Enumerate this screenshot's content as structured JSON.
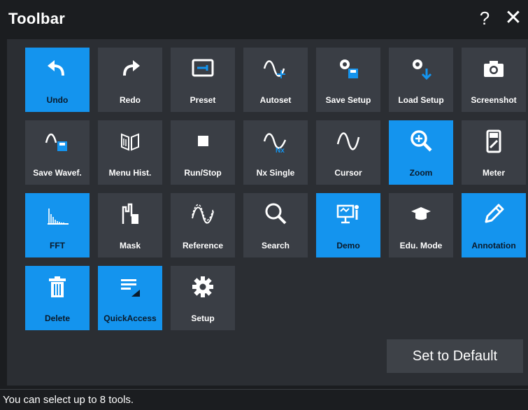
{
  "window": {
    "title": "Toolbar",
    "help_glyph": "?",
    "close_glyph": "✕"
  },
  "tools": [
    {
      "label": "Undo",
      "icon": "undo-icon",
      "active": true
    },
    {
      "label": "Redo",
      "icon": "redo-icon",
      "active": false
    },
    {
      "label": "Preset",
      "icon": "preset-icon",
      "active": false
    },
    {
      "label": "Autoset",
      "icon": "autoset-icon",
      "active": false
    },
    {
      "label": "Save Setup",
      "icon": "save-setup-icon",
      "active": false
    },
    {
      "label": "Load Setup",
      "icon": "load-setup-icon",
      "active": false
    },
    {
      "label": "Screenshot",
      "icon": "camera-icon",
      "active": false
    },
    {
      "label": "Save Wavef.",
      "icon": "save-waveform-icon",
      "active": false
    },
    {
      "label": "Menu Hist.",
      "icon": "menu-history-icon",
      "active": false
    },
    {
      "label": "Run/Stop",
      "icon": "stop-icon",
      "active": false
    },
    {
      "label": "Nx Single",
      "icon": "nx-single-icon",
      "active": false,
      "badge": "Nx"
    },
    {
      "label": "Cursor",
      "icon": "cursor-wave-icon",
      "active": false
    },
    {
      "label": "Zoom",
      "icon": "zoom-icon",
      "active": true
    },
    {
      "label": "Meter",
      "icon": "meter-icon",
      "active": false
    },
    {
      "label": "FFT",
      "icon": "fft-icon",
      "active": true
    },
    {
      "label": "Mask",
      "icon": "mask-icon",
      "active": false
    },
    {
      "label": "Reference",
      "icon": "reference-icon",
      "active": false
    },
    {
      "label": "Search",
      "icon": "search-icon",
      "active": false
    },
    {
      "label": "Demo",
      "icon": "demo-icon",
      "active": true
    },
    {
      "label": "Edu. Mode",
      "icon": "education-icon",
      "active": false
    },
    {
      "label": "Annotation",
      "icon": "pencil-icon",
      "active": true
    },
    {
      "label": "Delete",
      "icon": "trash-icon",
      "active": true
    },
    {
      "label": "QuickAccess",
      "icon": "quick-access-icon",
      "active": true
    },
    {
      "label": "Setup",
      "icon": "gear-icon",
      "active": false
    }
  ],
  "footer": {
    "default_button": "Set to Default",
    "status": "You can select up to 8 tools."
  },
  "colors": {
    "active": "#1494ee",
    "inactive": "#3a3e45",
    "panel": "#2b2e33",
    "background": "#1b1d20"
  }
}
